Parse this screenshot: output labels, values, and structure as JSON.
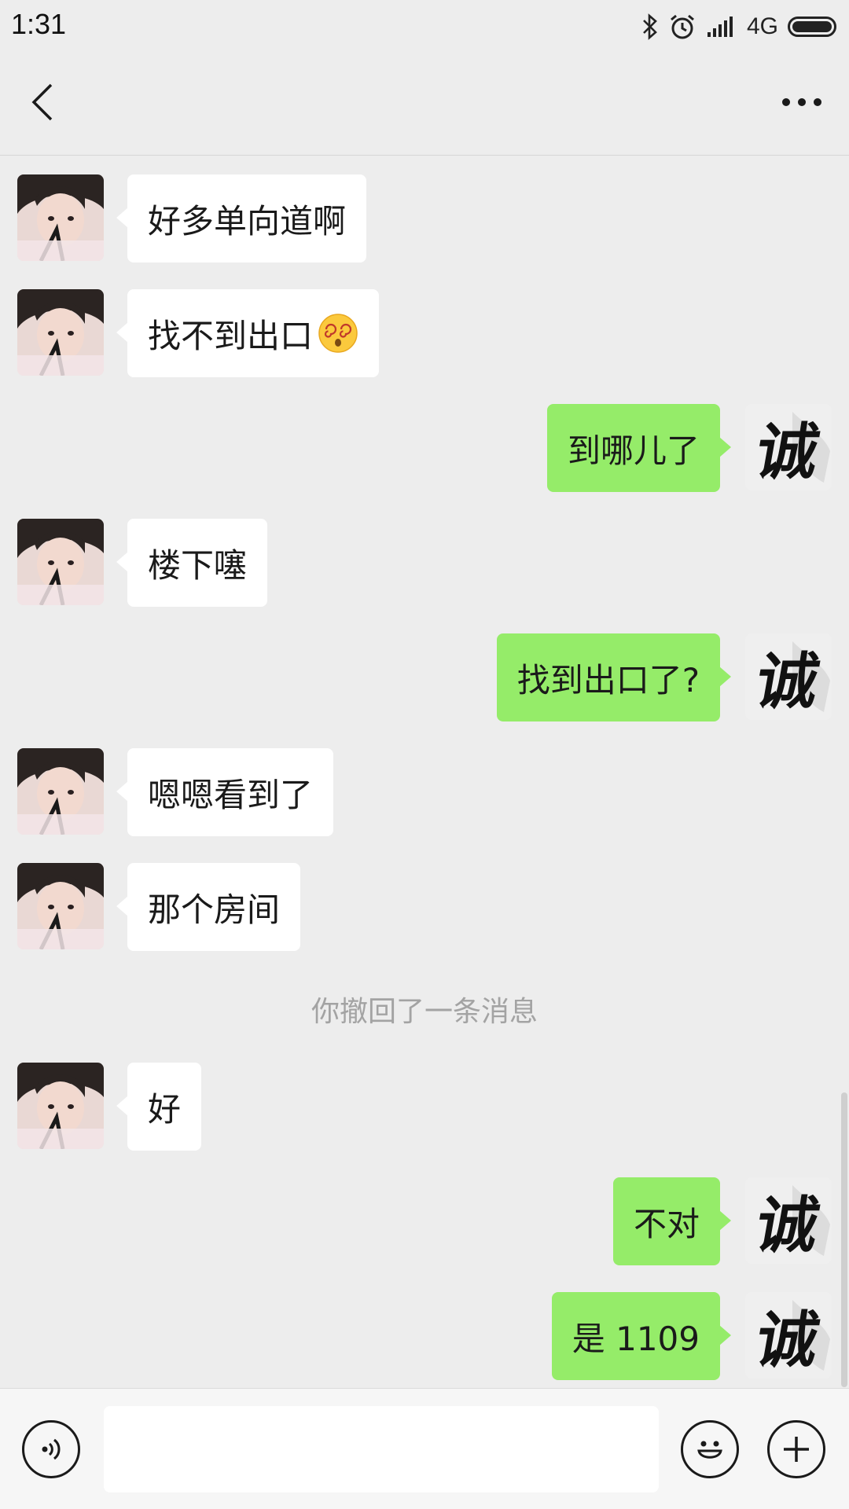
{
  "status_bar": {
    "time": "1:31",
    "network": "4G"
  },
  "header": {
    "title": ""
  },
  "messages": [
    {
      "side": "left",
      "text": "好多单向道啊"
    },
    {
      "side": "left",
      "text": "找不到出口",
      "emoji": "dizzy-face"
    },
    {
      "side": "right",
      "text": "到哪儿了"
    },
    {
      "side": "left",
      "text": "楼下噻"
    },
    {
      "side": "right",
      "text": "找到出口了?"
    },
    {
      "side": "left",
      "text": "嗯嗯看到了"
    },
    {
      "side": "left",
      "text": "那个房间"
    },
    {
      "side": "system",
      "text": "你撤回了一条消息"
    },
    {
      "side": "left",
      "text": "好"
    },
    {
      "side": "right",
      "text": "不对"
    },
    {
      "side": "right",
      "text": "是 1109"
    }
  ],
  "my_avatar_char": "诚",
  "input": {
    "value": "",
    "placeholder": ""
  },
  "colors": {
    "background": "#ededed",
    "own_bubble": "#95ec69",
    "other_bubble": "#ffffff"
  }
}
